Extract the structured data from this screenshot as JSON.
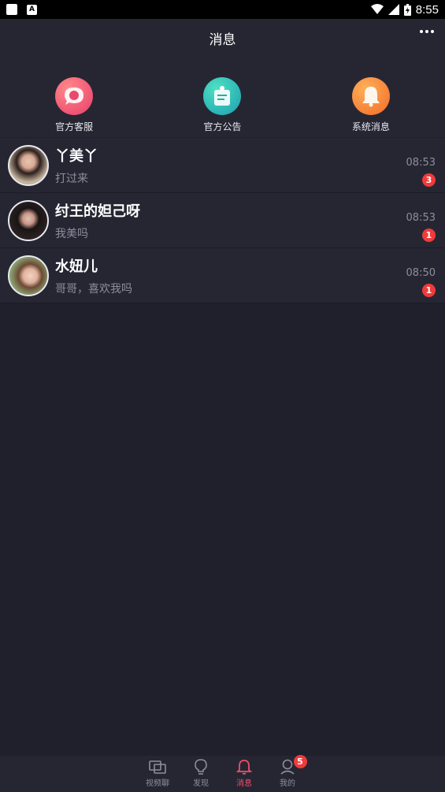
{
  "status_bar": {
    "time": "8:55"
  },
  "header": {
    "title": "消息"
  },
  "shortcuts": [
    {
      "label": "官方客服",
      "icon": "customer-service-icon",
      "color": "#ef4f6c"
    },
    {
      "label": "官方公告",
      "icon": "announcement-icon",
      "color": "#1fb0a8"
    },
    {
      "label": "系统消息",
      "icon": "bell-icon",
      "color": "#f47b2d"
    }
  ],
  "conversations": [
    {
      "name": "丫美丫",
      "message": "打过来",
      "time": "08:53",
      "unread": "3"
    },
    {
      "name": "纣王的妲己呀",
      "message": "我美吗",
      "time": "08:53",
      "unread": "1"
    },
    {
      "name": "水妞儿",
      "message": "哥哥，喜欢我吗",
      "time": "08:50",
      "unread": "1"
    }
  ],
  "tabs": [
    {
      "label": "视频聊",
      "icon": "video-chat-icon"
    },
    {
      "label": "发现",
      "icon": "bulb-icon"
    },
    {
      "label": "消息",
      "icon": "bell-icon",
      "active": true
    },
    {
      "label": "我的",
      "icon": "profile-icon",
      "badge": "5"
    }
  ],
  "colors": {
    "accent": "#f04e6a",
    "badge": "#f13a3a",
    "background": "#20202c",
    "panel": "#262633"
  }
}
